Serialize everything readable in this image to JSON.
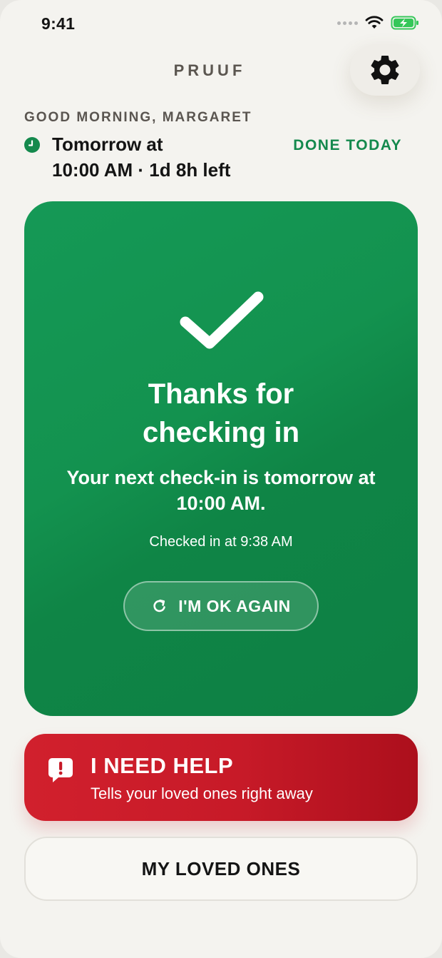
{
  "status_bar": {
    "time": "9:41",
    "icons": [
      "signal-dots-icon",
      "wifi-icon",
      "battery-charging-icon"
    ],
    "battery_color": "#35c759"
  },
  "header": {
    "brand": "PRUUF",
    "settings_icon": "gear-icon"
  },
  "greeting": "GOOD MORNING, MARGARET",
  "schedule": {
    "icon": "clock-icon",
    "line1": "Tomorrow at",
    "line2": "10:00 AM · 1d 8h left",
    "status_label": "DONE TODAY"
  },
  "status_card": {
    "icon": "checkmark-icon",
    "title_line1": "Thanks for",
    "title_line2": "checking in",
    "next_line1": "Your next check-in is tomorrow at",
    "next_line2": "10:00 AM.",
    "checked_in": "Checked in at 9:38 AM",
    "button_label": "I'M OK AGAIN",
    "button_icon": "refresh-icon",
    "color": "#13924f"
  },
  "help": {
    "icon": "alert-message-icon",
    "title": "I NEED HELP",
    "subtitle": "Tells your loved ones right away",
    "color": "#c71a28"
  },
  "loved_ones": {
    "label": "MY LOVED ONES"
  },
  "colors": {
    "background": "#f4f3ef",
    "accent_green": "#14894d",
    "text": "#141414"
  }
}
